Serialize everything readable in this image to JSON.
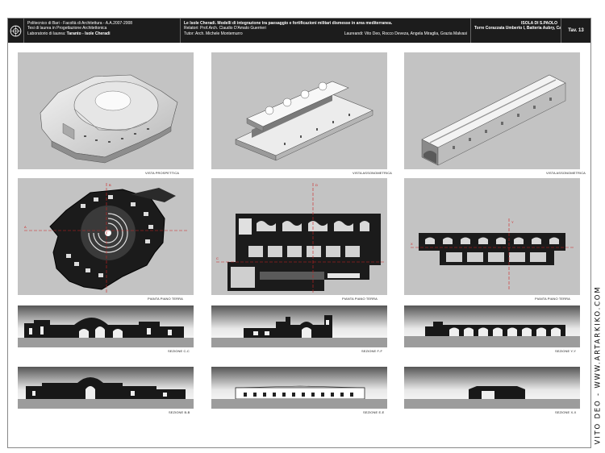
{
  "title_block": {
    "university_lines": [
      "Politecnico di Bari - Facoltà di Architettura - A.A.2007-2008",
      "Tesi di laurea in Progettazione Architettonica"
    ],
    "lab_label": "Laboratorio di laurea:",
    "lab_value": "Taranto - Isole Cheradi",
    "thesis_title": "Le Isole Cheradi. Modelli di integrazione tra paesaggio e fortificazioni militari dismesse in area mediterranea.",
    "relatori": "Relatori: Prof.Arch. Claudio D'Amato Guerrieri",
    "tutor": "Tutor: Arch. Michele Montemurro",
    "laureandi": "Laureandi: Vito Deo, Rocco Deveza, Angela Miraglia, Grazia Malvasi",
    "place_title": "ISOLA DI S.PAOLO",
    "place_subtitle": "Torre Corazzata Umberto I, Batteria Aubry, Casermetta",
    "sheet_number": "Tav. 13"
  },
  "captions": {
    "r1c1": "VISTA PROSPETTICA",
    "r1c2": "VISTA ASSONOMETRICA",
    "r1c3": "VISTA ASSONOMETRICA",
    "r2c1": "PIANTA PIANO TERRA",
    "r2c2": "PIANTA PIANO TERRA",
    "r2c3": "PIANTA PIANO TERRA",
    "r3c1": "SEZIONE C-C",
    "r3c2": "SEZIONE F-F",
    "r3c3": "SEZIONE Y-Y",
    "r4c1": "SEZIONE B-B",
    "r4c2": "SEZIONE E-E",
    "r4c3": "SEZIONE X-X"
  },
  "section_markers": {
    "a": "A",
    "b": "B",
    "c": "C",
    "d": "D",
    "e": "E",
    "f": "F",
    "x": "X",
    "y": "Y"
  },
  "credit": "VITO DEO - WWW.ARTARKIKO.COM",
  "colors": {
    "panel_bg": "#c3c3c3",
    "title_bar": "#1c1c1c",
    "section_line": "#d02020"
  }
}
